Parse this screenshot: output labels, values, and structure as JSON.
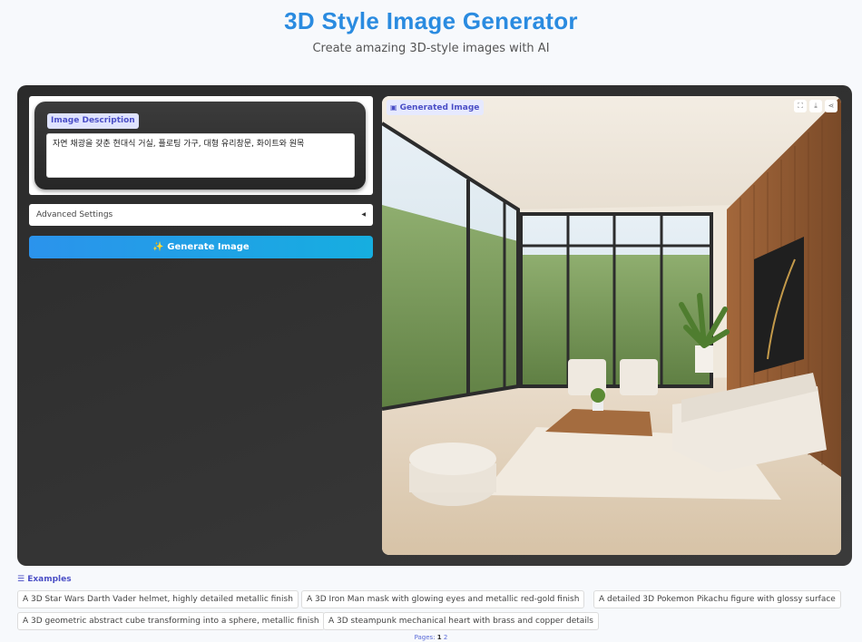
{
  "header": {
    "title": "3D Style Image Generator",
    "subtitle": "Create amazing 3D-style images with AI"
  },
  "prompt": {
    "label": "Image Description",
    "value": "자연 채광을 갖춘 현대식 거실, 플로팅 가구, 대형 유리창문, 화이트와 원목"
  },
  "advanced": {
    "label": "Advanced Settings",
    "arrow": "◀"
  },
  "generate": {
    "label": "✨ Generate Image"
  },
  "output": {
    "label": "Generated Image",
    "tools": [
      "fullscreen-icon",
      "download-icon",
      "share-icon"
    ]
  },
  "examples": {
    "heading": "☰ Examples",
    "items": [
      "A 3D Star Wars Darth Vader helmet, highly detailed metallic finish",
      "A 3D Iron Man mask with glowing eyes and metallic red-gold finish",
      "A detailed 3D Pokemon Pikachu figure with glossy surface",
      "A 3D geometric abstract cube transforming into a sphere, metallic finish",
      "A 3D steampunk mechanical heart with brass and copper details"
    ],
    "pages_label": "Pages:",
    "pages": [
      "1",
      "2"
    ]
  },
  "colors": {
    "accent": "#2a8be0",
    "label_text": "#4b4fc6",
    "panel_bg": "#2f2f2f"
  }
}
